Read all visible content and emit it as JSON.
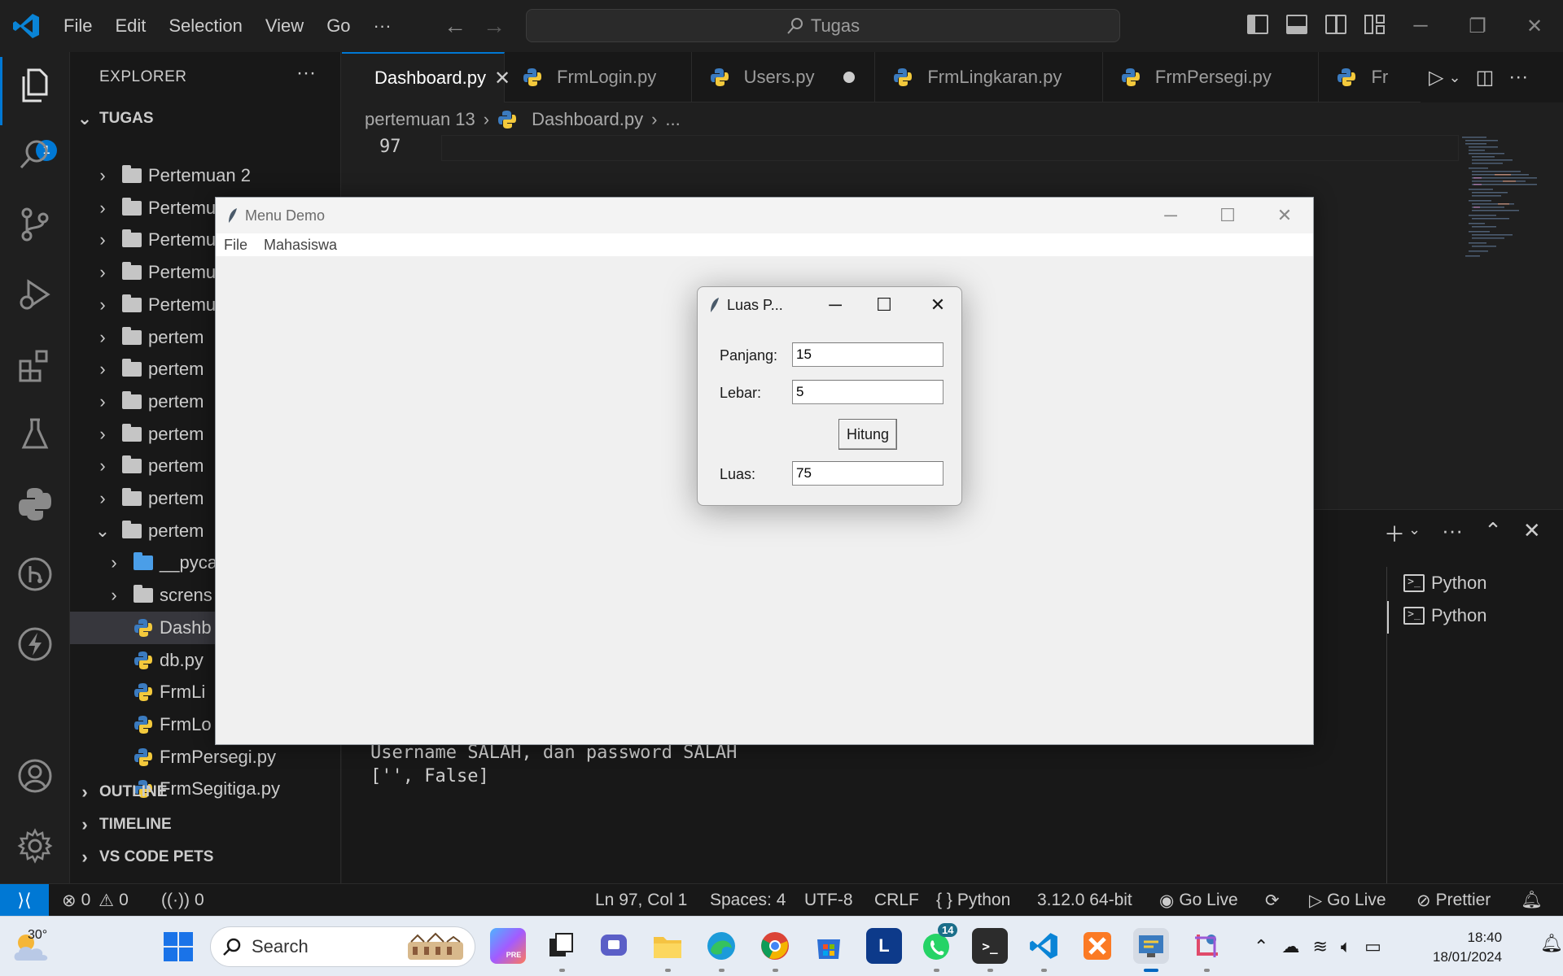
{
  "titlebar": {
    "menu": [
      "File",
      "Edit",
      "Selection",
      "View",
      "Go",
      "···"
    ],
    "search_text": "Tugas"
  },
  "activity": {
    "badge": "1"
  },
  "sidebar": {
    "title": "EXPLORER",
    "more": "···",
    "workspace": "TUGAS",
    "tree": [
      {
        "label": "Pertemuan 2",
        "type": "folder",
        "expanded": false
      },
      {
        "label": "Pertemuan 3",
        "type": "folder",
        "expanded": false
      },
      {
        "label": "Pertemu",
        "type": "folder",
        "expanded": false
      },
      {
        "label": "Pertemu",
        "type": "folder",
        "expanded": false
      },
      {
        "label": "Pertemu",
        "type": "folder",
        "expanded": false
      },
      {
        "label": "pertem",
        "type": "folder",
        "expanded": false
      },
      {
        "label": "pertem",
        "type": "folder",
        "expanded": false
      },
      {
        "label": "pertem",
        "type": "folder",
        "expanded": false
      },
      {
        "label": "pertem",
        "type": "folder",
        "expanded": false
      },
      {
        "label": "pertem",
        "type": "folder",
        "expanded": false
      },
      {
        "label": "pertem",
        "type": "folder",
        "expanded": false
      },
      {
        "label": "pertem",
        "type": "folder",
        "expanded": true
      },
      {
        "label": "__pyca",
        "type": "subfolder-special"
      },
      {
        "label": "screns",
        "type": "subfolder"
      },
      {
        "label": "Dashb",
        "type": "file",
        "selected": true
      },
      {
        "label": "db.py",
        "type": "file"
      },
      {
        "label": "FrmLi",
        "type": "file"
      },
      {
        "label": "FrmLo",
        "type": "file"
      },
      {
        "label": "FrmPersegi.py",
        "type": "file"
      },
      {
        "label": "FrmSegitiga.py",
        "type": "file"
      }
    ],
    "sections": [
      "OUTLINE",
      "TIMELINE",
      "VS CODE PETS"
    ]
  },
  "tabs": [
    {
      "label": "Dashboard.py",
      "active": true,
      "state": "close"
    },
    {
      "label": "FrmLogin.py",
      "active": false,
      "state": ""
    },
    {
      "label": "Users.py",
      "active": false,
      "state": "dirty"
    },
    {
      "label": "FrmLingkaran.py",
      "active": false,
      "state": ""
    },
    {
      "label": "FrmPersegi.py",
      "active": false,
      "state": ""
    },
    {
      "label": "Fr",
      "active": false,
      "state": ""
    }
  ],
  "breadcrumb": {
    "folder": "pertemuan 13",
    "file": "Dashboard.py",
    "more": "..."
  },
  "editor": {
    "line_number": "97"
  },
  "panel": {
    "output_lines": [
      "Username SALAH, dan password SALAH",
      "['', False]"
    ],
    "terminals": [
      "Python",
      "Python"
    ]
  },
  "statusbar": {
    "errors": "0",
    "warnings": "0",
    "ports": "0",
    "position": "Ln 97, Col 1",
    "spaces": "Spaces: 4",
    "encoding": "UTF-8",
    "eol": "CRLF",
    "language": "Python",
    "interpreter": "3.12.0 64-bit",
    "golive1": "Go Live",
    "golive2": "Go Live",
    "prettier": "Prettier"
  },
  "menu_demo": {
    "title": "Menu Demo",
    "menus": [
      "File",
      "Mahasiswa"
    ]
  },
  "luas_dialog": {
    "title": "Luas P...",
    "panjang_label": "Panjang:",
    "panjang_value": "15",
    "lebar_label": "Lebar:",
    "lebar_value": "5",
    "button": "Hitung",
    "luas_label": "Luas:",
    "luas_value": "75"
  },
  "taskbar": {
    "temperature": "30°",
    "search": "Search",
    "whatsapp_badge": "14",
    "time": "18:40",
    "date": "18/01/2024"
  }
}
